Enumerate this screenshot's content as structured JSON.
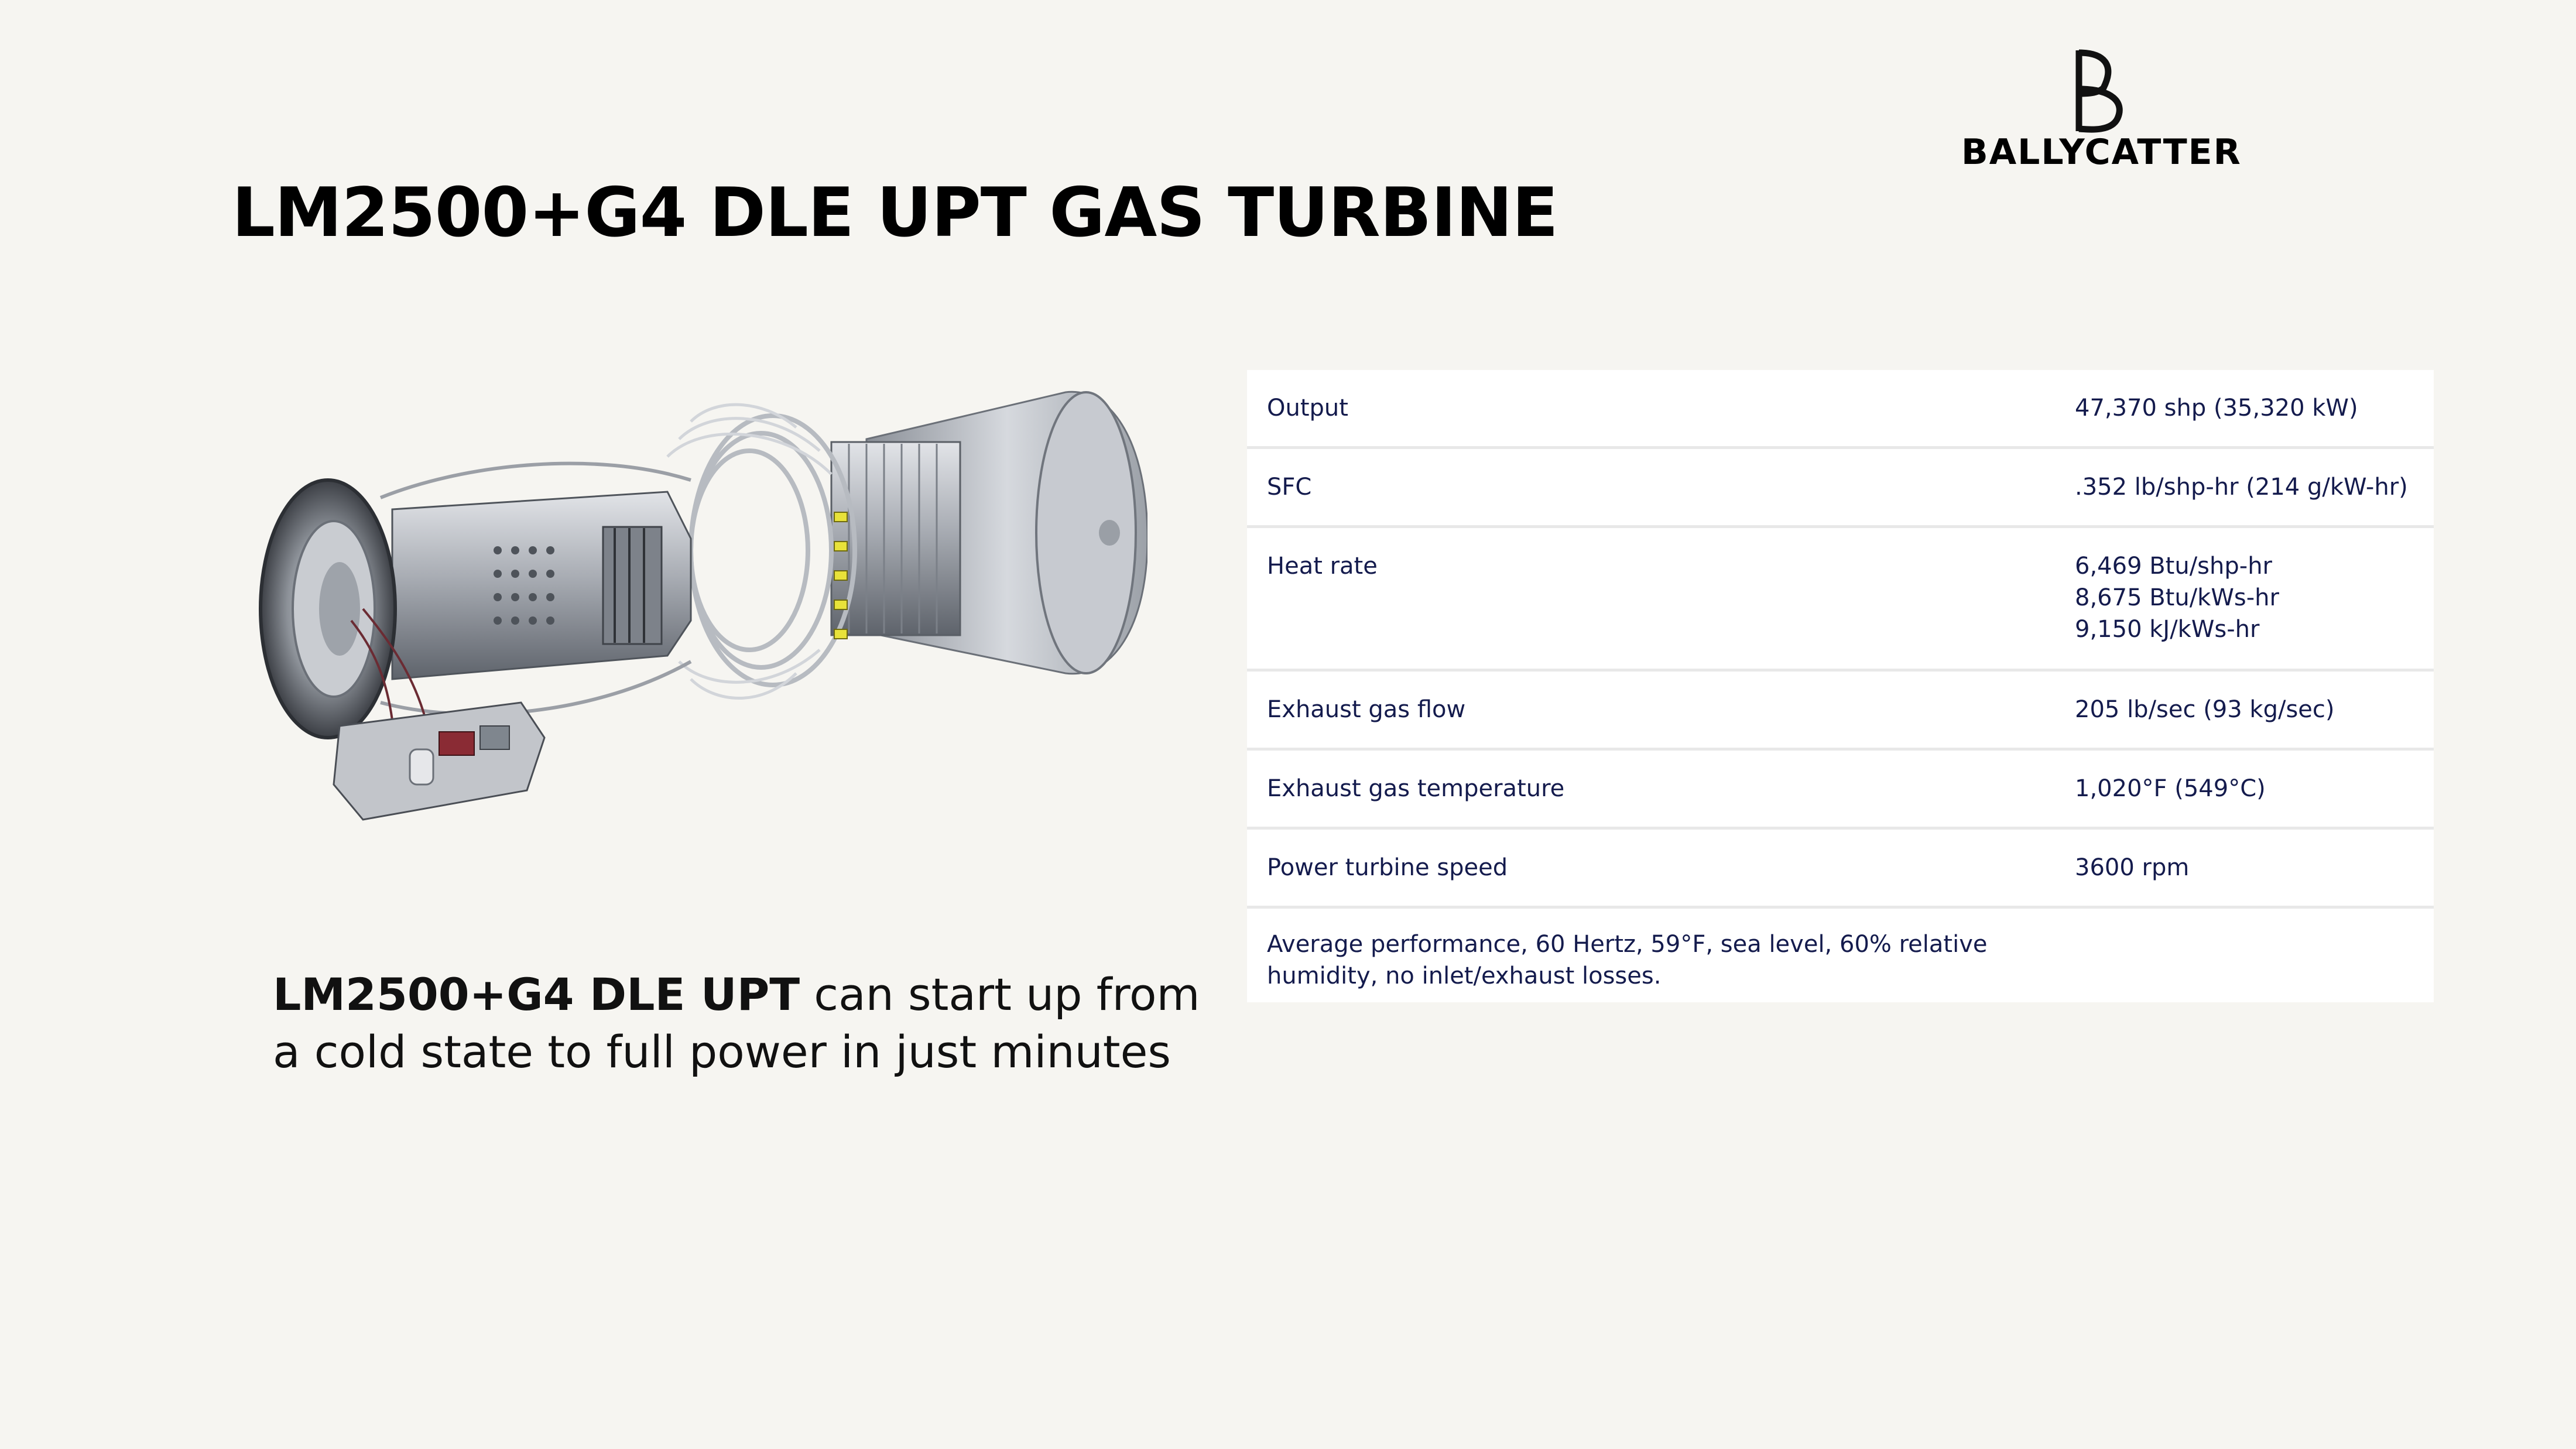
{
  "slide": {
    "title": "LM2500+G4 DLE UPT GAS TURBINE"
  },
  "logo": {
    "text": "BALLYCATTER",
    "icon": "b-monogram-icon"
  },
  "image": {
    "icon": "gas-turbine-illustration"
  },
  "caption": {
    "bold": "LM2500+G4 DLE UPT",
    "rest": " can start up from a cold state to full power in just minutes"
  },
  "specs": {
    "rows": [
      {
        "label": "Output",
        "values": [
          "47,370 shp (35,320 kW)"
        ]
      },
      {
        "label": "SFC",
        "values": [
          ".352 lb/shp-hr (214 g/kW-hr)"
        ]
      },
      {
        "label": "Heat rate",
        "values": [
          "6,469 Btu/shp-hr",
          "8,675 Btu/kWs-hr",
          "9,150 kJ/kWs-hr"
        ]
      },
      {
        "label": "Exhaust gas flow",
        "values": [
          "205 lb/sec (93 kg/sec)"
        ]
      },
      {
        "label": "Exhaust gas temperature",
        "values": [
          "1,020°F (549°C)"
        ]
      },
      {
        "label": "Power turbine speed",
        "values": [
          "3600 rpm"
        ]
      }
    ],
    "note": "Average performance, 60 Hertz, 59°F, sea level, 60% relative humidity, no inlet/exhaust losses."
  },
  "colors": {
    "background": "#f6f5f1",
    "table_text": "#141b4d",
    "indicator_yellow": "#e8e23a"
  }
}
